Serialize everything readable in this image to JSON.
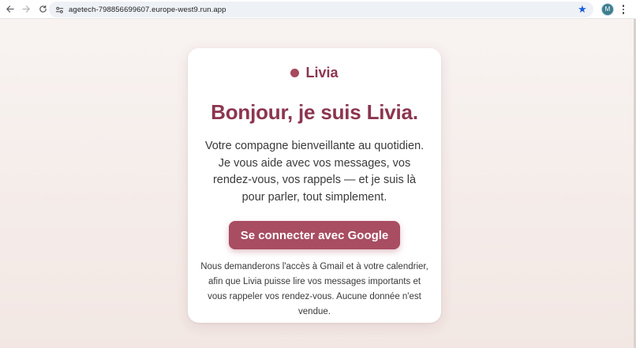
{
  "browser": {
    "url": "agetech-798856699607.europe-west9.run.app",
    "profile_initial": "M",
    "icons": {
      "back": "back-arrow-icon",
      "forward": "forward-arrow-icon",
      "reload": "reload-icon",
      "site_info": "tune-icon",
      "bookmark": "star-icon",
      "menu": "kebab-menu-icon"
    }
  },
  "card": {
    "brand_name": "Livia",
    "headline": "Bonjour, je suis Livia.",
    "intro": "Votre compagne bienveillante au quotidien. Je vous aide avec vos messages, vos rendez-vous, vos rappels — et je suis là pour parler, tout simplement.",
    "cta_label": "Se connecter avec Google",
    "disclaimer": "Nous demanderons l'accès à Gmail et à votre calendrier, afin que Livia puisse lire vos messages importants et vous rappeler vos rendez-vous. Aucune donnée n'est vendue."
  },
  "colors": {
    "accent": "#8c3550",
    "button": "#a84d62",
    "background": "#f3ebe8"
  }
}
